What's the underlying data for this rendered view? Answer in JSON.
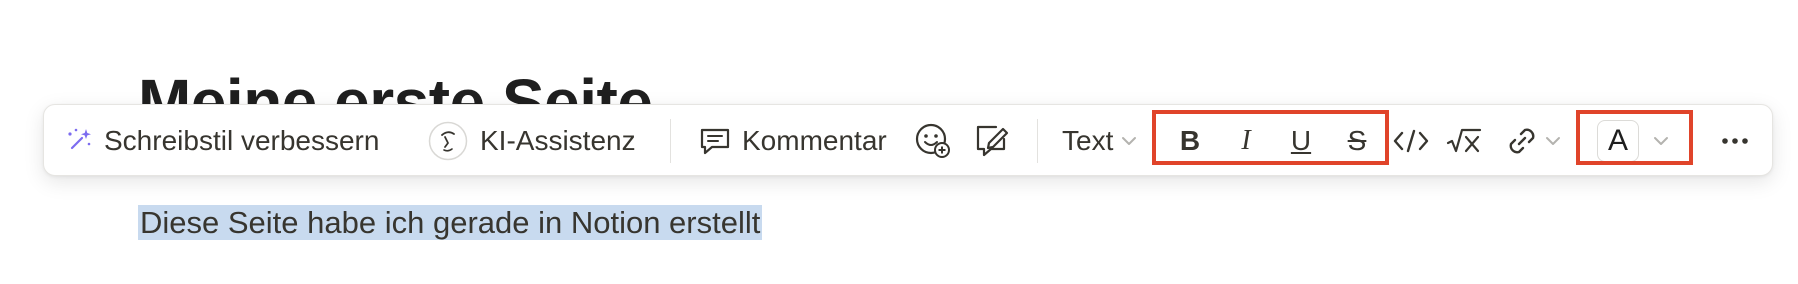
{
  "page": {
    "title": "Meine erste Seite",
    "paragraph": "Diese Seite habe ich gerade in Notion erstellt"
  },
  "toolbar": {
    "improve_writing_label": "Schreibstil verbessern",
    "ai_assist_label": "KI-Assistenz",
    "comment_label": "Kommentar",
    "block_type_label": "Text",
    "bold_glyph": "B",
    "italic_glyph": "I",
    "underline_glyph": "U",
    "strikethrough_glyph": "S",
    "color_glyph": "A",
    "icons": {
      "improve_writing": "sparkle-wand-icon",
      "ai_assist": "ai-face-icon",
      "comment": "comment-icon",
      "emoji": "emoji-add-icon",
      "suggest": "suggest-edit-icon",
      "code": "code-icon",
      "equation": "equation-icon",
      "link": "link-icon",
      "more": "more-icon"
    }
  },
  "colors": {
    "selection": "#c8daef",
    "highlight_box": "#e0442a",
    "sparkle": "#7c6cf0"
  }
}
